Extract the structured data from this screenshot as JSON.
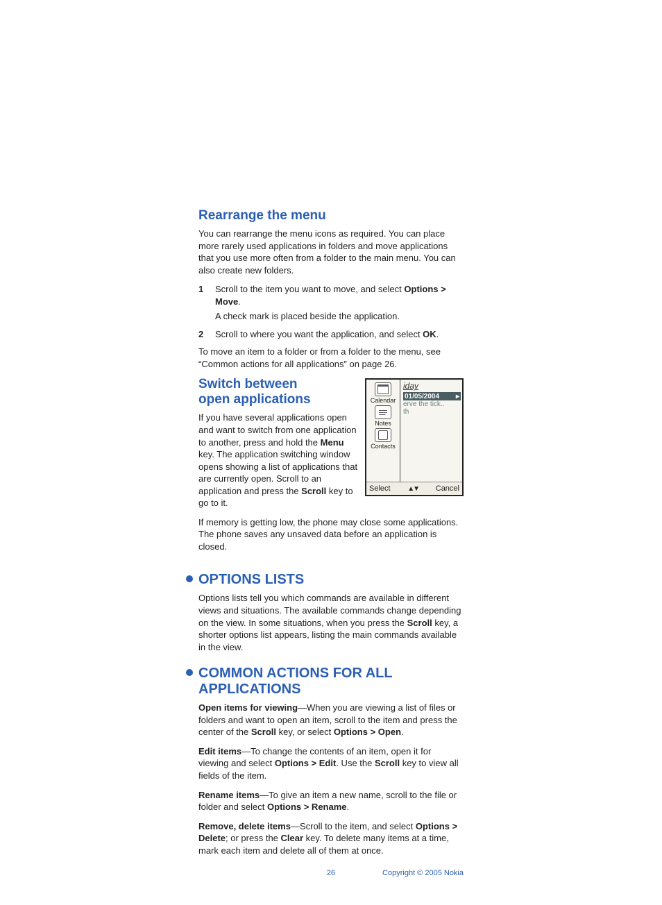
{
  "section_rearrange": {
    "title": "Rearrange the menu",
    "intro": "You can rearrange the menu icons as required. You can place more rarely used applications in folders and move applications that you use more often from a folder to the main menu. You can also create new folders.",
    "step1_num": "1",
    "step1_a": "Scroll to the item you want to move, and select ",
    "step1_b": "Options > Move",
    "step1_c": ".",
    "step1_d": "A check mark is placed beside the application.",
    "step2_num": "2",
    "step2_a": "Scroll to where you want the application, and select ",
    "step2_b": "OK",
    "step2_c": ".",
    "outro": "To move an item to a folder or from a folder to the menu, see “Common actions for all applications” on page 26."
  },
  "section_switch": {
    "title_line1": "Switch between",
    "title_line2": "open applications",
    "p1_a": "If you have several applications open and want to switch from one application to another, press and hold the ",
    "p1_b": "Menu",
    "p1_c": " key. The application switching window opens showing a list of applications that are currently open. Scroll to an application and press the ",
    "p1_d": "Scroll",
    "p1_e": " key to go to it.",
    "p2": "If memory is getting low, the phone may close some applications. The phone saves any unsaved data before an application is closed."
  },
  "figure": {
    "app1": "Calendar",
    "app2": "Notes",
    "app3": "Contacts",
    "heading": "iday",
    "date": "01/05/2004",
    "row1": "erve the tick..",
    "row2": "th",
    "softkey_left": "Select",
    "softkey_right": "Cancel"
  },
  "section_options": {
    "title": "OPTIONS LISTS",
    "p_a": "Options lists tell you which commands are available in different views and situations. The available commands change depending on the view. In some situations, when you press the ",
    "p_b": "Scroll",
    "p_c": " key, a shorter options list appears, listing the main commands available in the view."
  },
  "section_common": {
    "title": "COMMON ACTIONS FOR ALL APPLICATIONS",
    "open_a": "Open items for viewing",
    "open_b": "—When you are viewing a list of files or folders and want to open an item, scroll to the item and press the center of the ",
    "open_c": "Scroll",
    "open_d": " key, or select ",
    "open_e": "Options > Open",
    "open_f": ".",
    "edit_a": "Edit items",
    "edit_b": "—To change the contents of an item, open it for viewing and select ",
    "edit_c": "Options > Edit",
    "edit_d": ". Use the ",
    "edit_e": "Scroll",
    "edit_f": " key to view all fields of the item.",
    "rename_a": "Rename items",
    "rename_b": "—To give an item a new name, scroll to the file or folder and select ",
    "rename_c": "Options > Rename",
    "rename_d": ".",
    "remove_a": "Remove, delete items",
    "remove_b": "—Scroll to the item, and select ",
    "remove_c": "Options > Delete",
    "remove_d": "; or press the ",
    "remove_e": "Clear",
    "remove_f": " key. To delete many items at a time, mark each item and delete all of them at once."
  },
  "footer": {
    "page": "26",
    "copyright": "Copyright © 2005 Nokia"
  }
}
